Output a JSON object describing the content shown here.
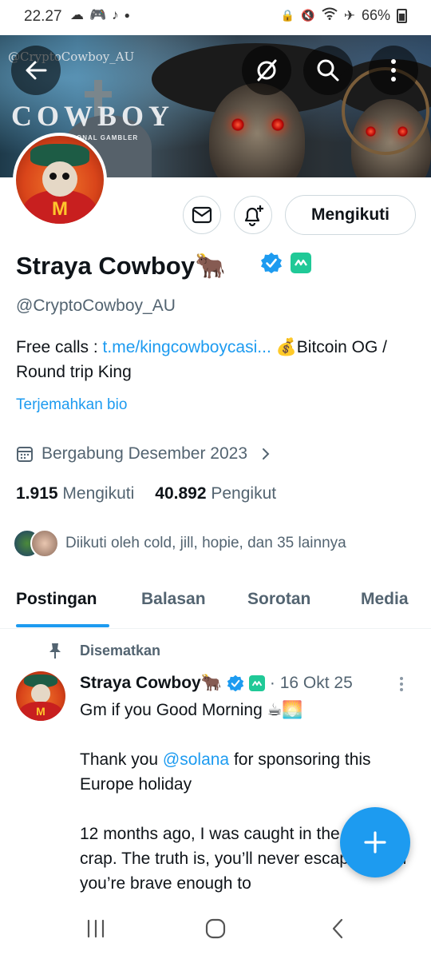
{
  "status_bar": {
    "time": "22.27",
    "battery": "66%",
    "icons": [
      "cloud-icon",
      "gamepad-icon",
      "tiktok-icon",
      "dot-icon",
      "lock-icon",
      "mute-icon",
      "wifi-icon",
      "airplane-icon",
      "battery-icon"
    ]
  },
  "banner": {
    "handle_watermark": "@CryptoCowboy_AU",
    "title": "COWBOY",
    "subtitle": "ONAL GAMBLER"
  },
  "profile": {
    "name": "Straya Cowboy",
    "name_emoji": "🐂",
    "handle": "@CryptoCowboy_AU",
    "bio_prefix": "Free calls : ",
    "bio_link": "t.me/kingcowboycasi...",
    "bio_suffix": " 💰Bitcoin OG / Round trip King",
    "translate": "Terjemahkan bio",
    "joined": "Bergabung Desember 2023",
    "following_count": "1.915",
    "following_label": "Mengikuti",
    "followers_count": "40.892",
    "followers_label": "Pengikut",
    "followed_by": "Diikuti oleh cold, jill, hopie, dan 35 lainnya"
  },
  "actions": {
    "follow_button": "Mengikuti"
  },
  "tabs": [
    {
      "label": "Postingan",
      "active": true
    },
    {
      "label": "Balasan",
      "active": false
    },
    {
      "label": "Sorotan",
      "active": false
    },
    {
      "label": "Media",
      "active": false
    }
  ],
  "post": {
    "pinned_label": "Disematkan",
    "author": "Straya Cowboy",
    "author_emoji": "🐂",
    "date": "· 16 Okt 25",
    "line1": "Gm if you Good Morning ☕🌅",
    "line2_pre": "Thank you ",
    "mention": "@solana",
    "line2_post": " for sponsoring this Europe holiday",
    "line3": "12 months ago, I was caught in the 9-to-5 crap. The truth is, you’ll never escape it until you’re brave enough to"
  },
  "colors": {
    "accent": "#1d9bf0",
    "text_primary": "#0f1419",
    "text_secondary": "#536471",
    "verified": "#1d9bf0",
    "green_badge": "#20c997"
  }
}
